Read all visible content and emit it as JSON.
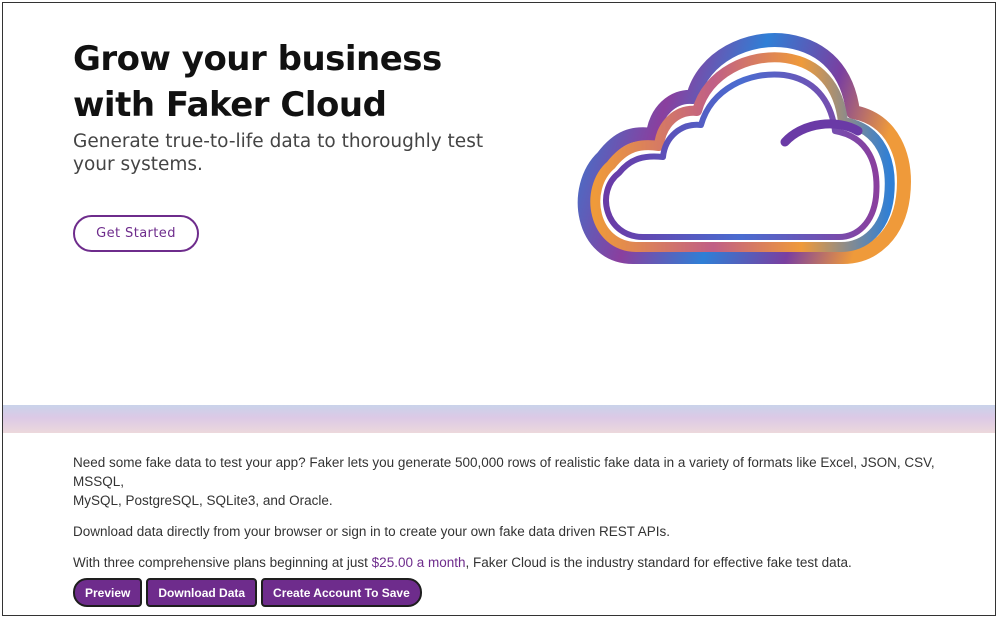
{
  "hero": {
    "title_line1": "Grow your business",
    "title_line2": "with Faker Cloud",
    "subtitle_line1": "Generate true-to-life data to thoroughly test",
    "subtitle_line2": "your systems.",
    "cta_label": "Get Started",
    "illustration_icon": "cloud-icon"
  },
  "info": {
    "para1_line1": "Need some fake data to test your app? Faker lets you generate 500,000 rows of realistic fake data in a variety of formats like Excel, JSON, CSV, MSSQL,",
    "para1_line2": "MySQL, PostgreSQL, SQLite3, and Oracle.",
    "para2": "Download data directly from your browser or sign in to create your own fake data driven REST APIs.",
    "para3_before": "With three comprehensive plans beginning at just ",
    "para3_link": "$25.00 a month",
    "para3_after": ", Faker Cloud is the industry standard for effective fake test data."
  },
  "actions": {
    "preview_label": "Preview",
    "download_label": "Download Data",
    "create_label": "Create Account To Save"
  },
  "colors": {
    "brand_purple": "#6e2c8c",
    "cloud_blue": "#2f7fd6",
    "cloud_orange": "#ef9a3a",
    "cloud_violet": "#7a3fa0"
  }
}
